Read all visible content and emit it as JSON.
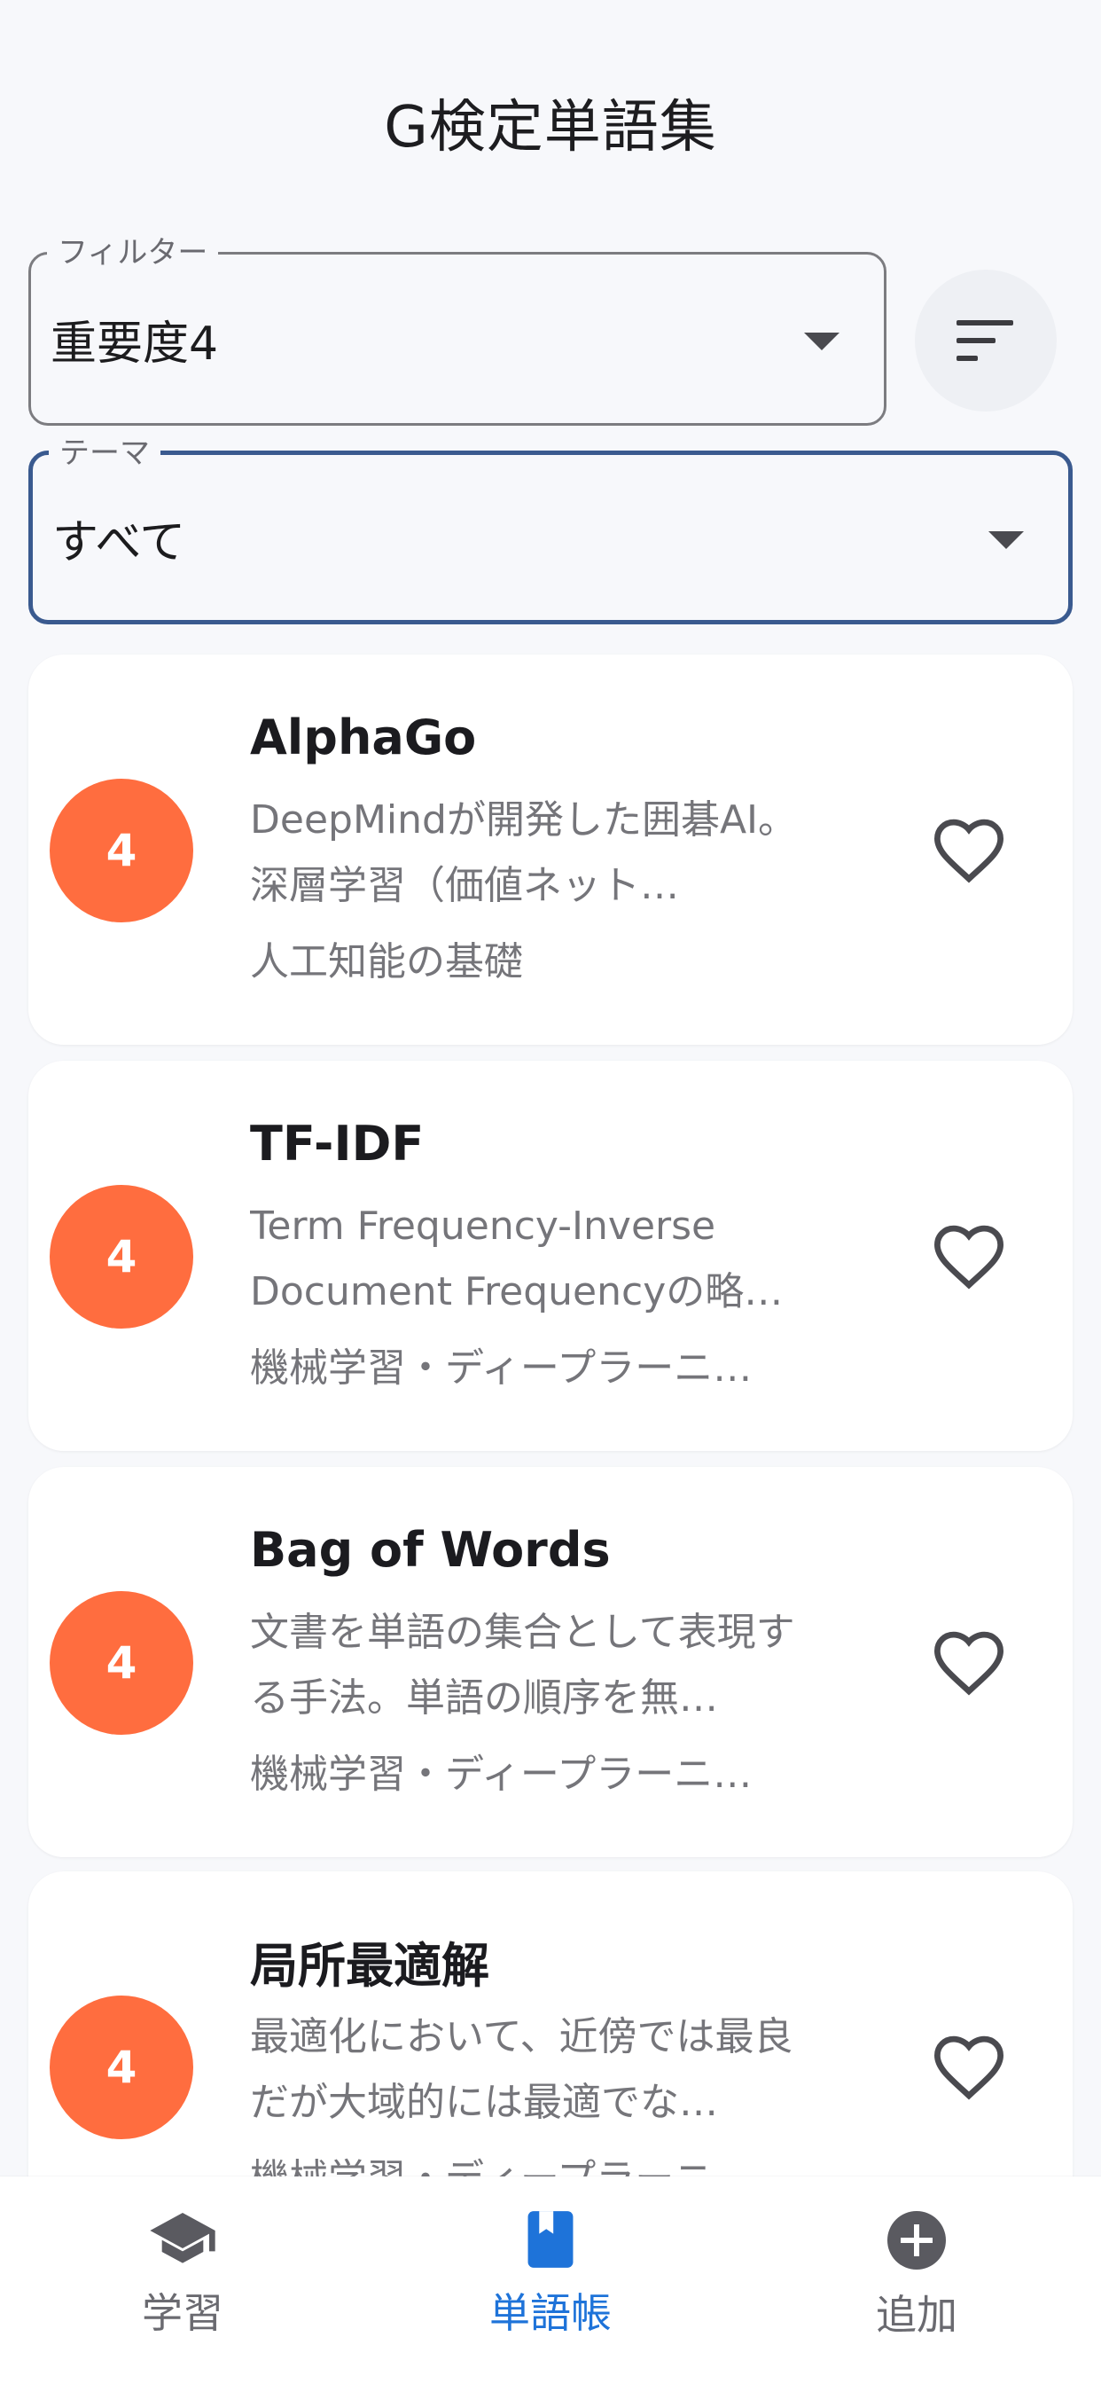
{
  "header": {
    "title": "G検定単語集"
  },
  "filter": {
    "label": "フィルター",
    "value": "重要度4"
  },
  "theme_select": {
    "label": "テーマ",
    "value": "すべて"
  },
  "cards": [
    {
      "importance": "4",
      "term": "AlphaGo",
      "description": "DeepMindが開発した囲碁AI。深層学習（価値ネット…",
      "theme": "人工知能の基礎"
    },
    {
      "importance": "4",
      "term": "TF-IDF",
      "description": "Term Frequency-Inverse Document Frequencyの略…",
      "theme": "機械学習・ディープラーニ…"
    },
    {
      "importance": "4",
      "term": "Bag of Words",
      "description": "文書を単語の集合として表現する手法。単語の順序を無…",
      "theme": "機械学習・ディープラーニ…"
    },
    {
      "importance": "4",
      "term": "局所最適解",
      "description": "最適化において、近傍では最良だが大域的には最適でな…",
      "theme": "機械学習・ディープラーニ…"
    }
  ],
  "bottom_nav": {
    "items": [
      {
        "label": "学習",
        "icon": "graduation-cap-icon"
      },
      {
        "label": "単語帳",
        "icon": "book-icon"
      },
      {
        "label": "追加",
        "icon": "add-circle-icon"
      }
    ],
    "active_index": 1
  },
  "colors": {
    "badge": "#ff6d3f",
    "active_nav": "#1e73d9",
    "focused_border": "#3a5a8f"
  }
}
